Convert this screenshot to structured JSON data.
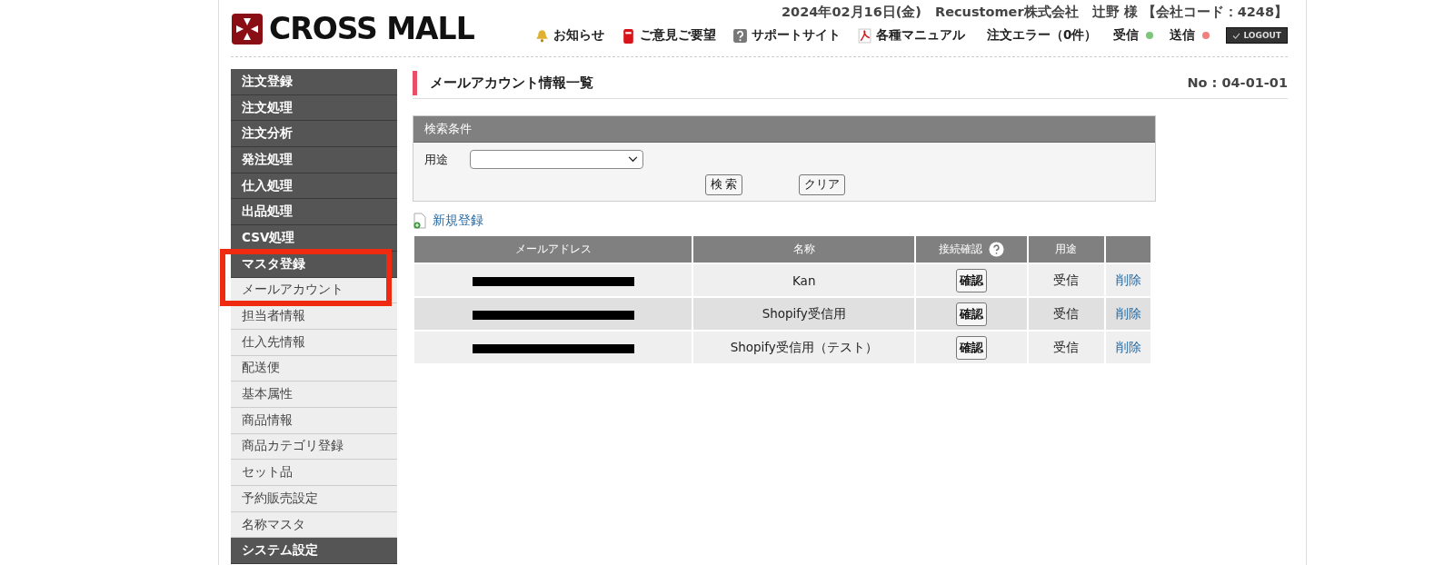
{
  "header": {
    "logo": "CROSS MALL",
    "info": "2024年02月16日(金)　Recustomer株式会社　辻野 様 【会社コード：4248】",
    "links": [
      {
        "kind": "bell",
        "label": "お知らせ"
      },
      {
        "kind": "mailbox",
        "label": "ご意見ご要望"
      },
      {
        "kind": "help",
        "label": "サポートサイト"
      },
      {
        "kind": "pdf",
        "label": "各種マニュアル"
      },
      {
        "kind": "plain",
        "label": "注文エラー（0件）"
      }
    ],
    "status": [
      {
        "label": "受信",
        "color": "#7cc67c"
      },
      {
        "label": "送信",
        "color": "#f08080"
      }
    ],
    "logout": "LOGOUT"
  },
  "sidebar": {
    "groups": [
      {
        "highlighted": false,
        "items": [
          {
            "label": "注文登録",
            "kind": "section"
          },
          {
            "label": "注文処理",
            "kind": "section"
          },
          {
            "label": "注文分析",
            "kind": "section"
          },
          {
            "label": "発注処理",
            "kind": "section"
          },
          {
            "label": "仕入処理",
            "kind": "section"
          },
          {
            "label": "出品処理",
            "kind": "section"
          },
          {
            "label": "CSV処理",
            "kind": "section"
          }
        ]
      },
      {
        "highlighted": true,
        "items": [
          {
            "label": "マスタ登録",
            "kind": "section"
          },
          {
            "label": "メールアカウント",
            "kind": "item"
          }
        ]
      },
      {
        "highlighted": false,
        "items": [
          {
            "label": "担当者情報",
            "kind": "item"
          },
          {
            "label": "仕入先情報",
            "kind": "item"
          },
          {
            "label": "配送便",
            "kind": "item"
          },
          {
            "label": "基本属性",
            "kind": "item"
          },
          {
            "label": "商品情報",
            "kind": "item"
          },
          {
            "label": "商品カテゴリ登録",
            "kind": "item"
          },
          {
            "label": "セット品",
            "kind": "item"
          },
          {
            "label": "予約販売設定",
            "kind": "item"
          },
          {
            "label": "名称マスタ",
            "kind": "item"
          },
          {
            "label": "システム設定",
            "kind": "section"
          }
        ]
      }
    ]
  },
  "page": {
    "title": "メールアカウント情報一覧",
    "page_no": "No : 04-01-01"
  },
  "search": {
    "heading": "検索条件",
    "field_label": "用途",
    "buttons": [
      "検 索",
      "クリア"
    ]
  },
  "new_link": "新規登録",
  "table": {
    "columns": [
      "メールアドレス",
      "名称",
      "接続確認",
      "用途"
    ],
    "rows": [
      {
        "name": "Kan",
        "check": "確認",
        "usage": "受信",
        "delete": "削除"
      },
      {
        "name": "Shopify受信用",
        "check": "確認",
        "usage": "受信",
        "delete": "削除"
      },
      {
        "name": "Shopify受信用（テスト）",
        "check": "確認",
        "usage": "受信",
        "delete": "削除"
      }
    ]
  }
}
